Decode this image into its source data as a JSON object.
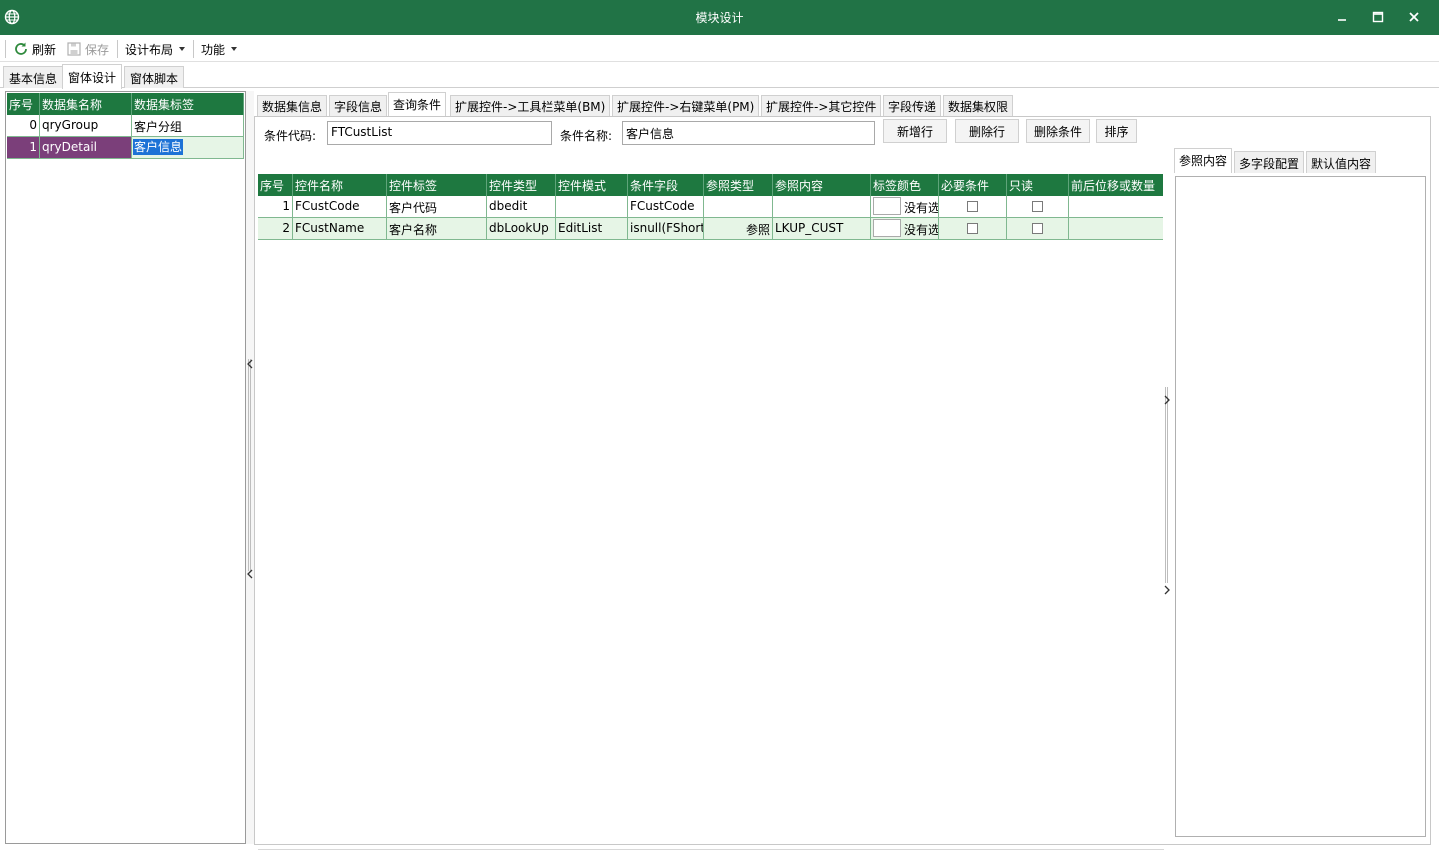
{
  "window": {
    "title": "模块设计",
    "controls": {
      "minimize": "minimize-icon",
      "maximize": "maximize-icon",
      "close": "close-icon"
    }
  },
  "toolbar": {
    "refresh_label": "刷新",
    "save_label": "保存",
    "layout_label": "设计布局",
    "function_label": "功能"
  },
  "main_tabs": [
    "基本信息",
    "窗体设计",
    "窗体脚本"
  ],
  "dataset_grid": {
    "headers": [
      "序号",
      "数据集名称",
      "数据集标签"
    ],
    "rows": [
      {
        "index": "0",
        "name": "qryGroup",
        "label": "客户分组"
      },
      {
        "index": "1",
        "name": "qryDetail",
        "label": "客户信息"
      }
    ]
  },
  "sub_tabs": [
    "数据集信息",
    "字段信息",
    "查询条件",
    "扩展控件->工具栏菜单(BM)",
    "扩展控件->右键菜单(PM)",
    "扩展控件->其它控件",
    "字段传递",
    "数据集权限"
  ],
  "condition_form": {
    "code_label": "条件代码:",
    "code_value": "FTCustList",
    "name_label": "条件名称:",
    "name_value": "客户信息",
    "buttons": [
      "新增行",
      "删除行",
      "删除条件",
      "排序"
    ]
  },
  "condition_grid": {
    "headers": [
      "序号",
      "控件名称",
      "控件标签",
      "控件类型",
      "控件模式",
      "条件字段",
      "参照类型",
      "参照内容",
      "标签颜色",
      "必要条件",
      "只读",
      "前后位移或数量"
    ],
    "rows": [
      {
        "index": "1",
        "name": "FCustCode",
        "label": "客户代码",
        "type": "dbedit",
        "mode": "",
        "field": "FCustCode",
        "ref_type": "",
        "ref_content": "",
        "color_text": "没有选",
        "required": false,
        "readonly": false,
        "offset": ""
      },
      {
        "index": "2",
        "name": "FCustName",
        "label": "客户名称",
        "type": "dbLookUp",
        "mode": "EditList",
        "field": "isnull(FShort",
        "ref_type": "参照",
        "ref_content": "LKUP_CUST",
        "color_text": "没有选",
        "required": false,
        "readonly": false,
        "offset": ""
      }
    ]
  },
  "ref_tabs": [
    "参照内容",
    "多字段配置",
    "默认值内容"
  ],
  "colors": {
    "title_bar": "#217346",
    "grid_header": "#1e7840",
    "selected_row": "#7b3f7a",
    "alt_row": "#e6f5e6",
    "selection_highlight": "#1d72d6"
  }
}
